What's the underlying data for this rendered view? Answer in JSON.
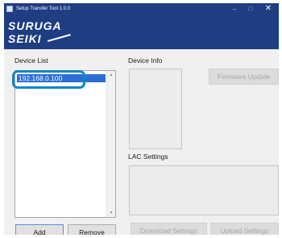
{
  "window": {
    "title": "Setup Transfer Tool 1.0.0",
    "controls": {
      "minimize": "–",
      "maximize": "□",
      "close": "✕"
    }
  },
  "banner": {
    "logo_line1": "SURUGA",
    "logo_line2": "SEIKI",
    "colors": {
      "background": "#1e3d82",
      "logo_text": "#ffffff"
    }
  },
  "device_list": {
    "label": "Device List",
    "items": [
      "192.168.0.100"
    ],
    "selected_index": 0,
    "add_label": "Add",
    "remove_label": "Remove"
  },
  "device_info": {
    "label": "Device Info",
    "firmware_update_label": "Firmware Update",
    "firmware_update_enabled": false
  },
  "lac_settings": {
    "label": "LAC Settings",
    "download_label": "Download Settings",
    "upload_label": "Upload Settings",
    "download_enabled": false,
    "upload_enabled": false
  },
  "annotation": {
    "color": "#0f86c8",
    "target": "device_list.items.0"
  },
  "colors": {
    "selection": "#2b6fd6",
    "titlebar": "#1e3d82",
    "window_bg": "#f0f0f0"
  }
}
